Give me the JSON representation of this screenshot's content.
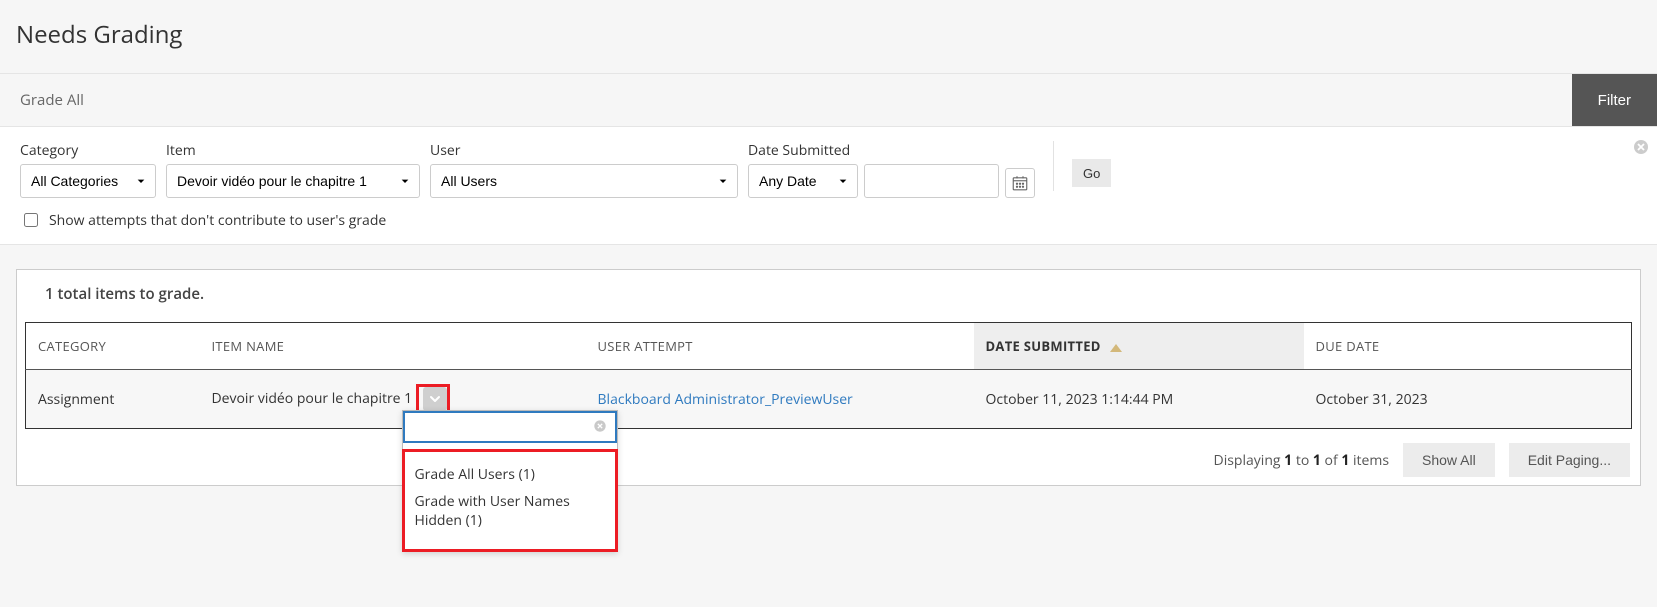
{
  "page_title": "Needs Grading",
  "toolbar": {
    "grade_all_label": "Grade All",
    "filter_label": "Filter"
  },
  "filters": {
    "category_label": "Category",
    "category_value": "All Categories",
    "item_label": "Item",
    "item_value": "Devoir vidéo pour le chapitre 1",
    "user_label": "User",
    "user_value": "All Users",
    "date_label": "Date Submitted",
    "anydate_value": "Any Date",
    "date_input_value": "",
    "go_label": "Go",
    "show_attempts_label": "Show attempts that don't contribute to user's grade"
  },
  "summary": {
    "total_text": "1 total items to grade."
  },
  "table": {
    "headers": {
      "category": "CATEGORY",
      "item": "ITEM NAME",
      "user": "USER ATTEMPT",
      "date": "DATE SUBMITTED",
      "due": "DUE DATE"
    },
    "rows": [
      {
        "category": "Assignment",
        "item": "Devoir vidéo pour le chapitre 1",
        "user": "Blackboard Administrator_PreviewUser",
        "date": "October 11, 2023 1:14:44 PM",
        "due": "October 31, 2023"
      }
    ]
  },
  "dropdown": {
    "opt1": "Grade All Users (1)",
    "opt2": "Grade with User Names Hidden (1)"
  },
  "footer": {
    "displaying": "Displaying",
    "to": "to",
    "of": "of",
    "items": "items",
    "from": "1",
    "to_num": "1",
    "total": "1",
    "show_all": "Show All",
    "edit_paging": "Edit Paging..."
  }
}
